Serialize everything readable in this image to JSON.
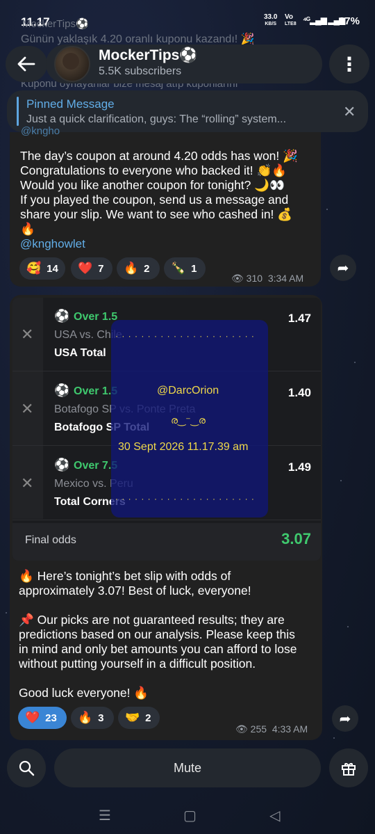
{
  "status_bar": {
    "time": "11.17",
    "speed_value": "33.0",
    "speed_unit": "KB/S",
    "network_top": "Vo",
    "network_bottom": "LTE8",
    "signal_label": "⁴ᴳ",
    "battery": "87%"
  },
  "behind_texts": [
    "MockerTips⚽",
    "Günün yaklaşık 4.20 oranlı kuponu kazandı! 🎉",
    "Kuponu oynayanlar bize mesaj atıp kuponlarını"
  ],
  "header": {
    "channel_name": "MockerTips⚽",
    "subscribers": "5.5K subscribers"
  },
  "pinned": {
    "title": "Pinned Message",
    "text": "Just a quick clarification, guys:  The “rolling” system..."
  },
  "message1": {
    "partial_top": "@kngho",
    "text": "The day’s coupon at around 4.20 odds has won! 🎉\nCongratulations to everyone who backed it! 👏🔥\nWould you like another coupon for tonight? 🌙👀\nIf you played the coupon, send us a message and\nshare your slip. We want to see who cashed in! 💰\n🔥",
    "mention": "@knghowlet",
    "reactions": [
      {
        "emoji": "🥰",
        "count": "14"
      },
      {
        "emoji": "❤️",
        "count": "7"
      },
      {
        "emoji": "🔥",
        "count": "2"
      },
      {
        "emoji": "🍾",
        "count": "1"
      }
    ],
    "views": "310",
    "time": "3:34 AM"
  },
  "bet_slip": {
    "rows": [
      {
        "pick": "Over 1.5",
        "match": "USA vs. Chile",
        "market": "USA Total",
        "odds": "1.47"
      },
      {
        "pick": "Over 1.5",
        "match": "Botafogo SP vs. Ponte Preta",
        "market": "Botafogo SP Total",
        "odds": "1.40"
      },
      {
        "pick": "Over 7.5",
        "match": "Mexico vs. Peru",
        "market": "Total Corners",
        "odds": "1.49"
      }
    ],
    "final_label": "Final odds",
    "final_value": "3.07"
  },
  "watermark": {
    "user": "@DarcOrion",
    "face": "ര‿⁻‿ര",
    "date": "30 Sept 2026 11.17.39 am",
    "dots": "· · · · · · · · · · · · · · · · · · · · · ·"
  },
  "message2": {
    "text": "🔥 Here’s tonight’s bet slip with odds of\napproximately 3.07! Best of luck, everyone!\n\n📌 Our picks are not guaranteed results; they are\npredictions based on our analysis. Please keep this\nin mind and only bet amounts you can afford to lose\nwithout putting yourself in a difficult position.\n\nGood luck everyone! 🔥",
    "reactions": [
      {
        "emoji": "❤️",
        "count": "23",
        "selected": true
      },
      {
        "emoji": "🔥",
        "count": "3"
      },
      {
        "emoji": "🤝",
        "count": "2"
      }
    ],
    "views": "255",
    "time": "4:33 AM"
  },
  "bottom": {
    "mute_label": "Mute"
  },
  "icons": {
    "back": "back-arrow-icon",
    "menu": "more-vertical-icon",
    "close": "close-icon",
    "search": "search-icon",
    "gift": "gift-icon",
    "share": "share-icon",
    "eye": "eye-icon"
  },
  "colors": {
    "accent": "#62aee8",
    "green": "#3fc96e",
    "bubble": "#212121",
    "selected_reaction": "#3a85d5"
  }
}
